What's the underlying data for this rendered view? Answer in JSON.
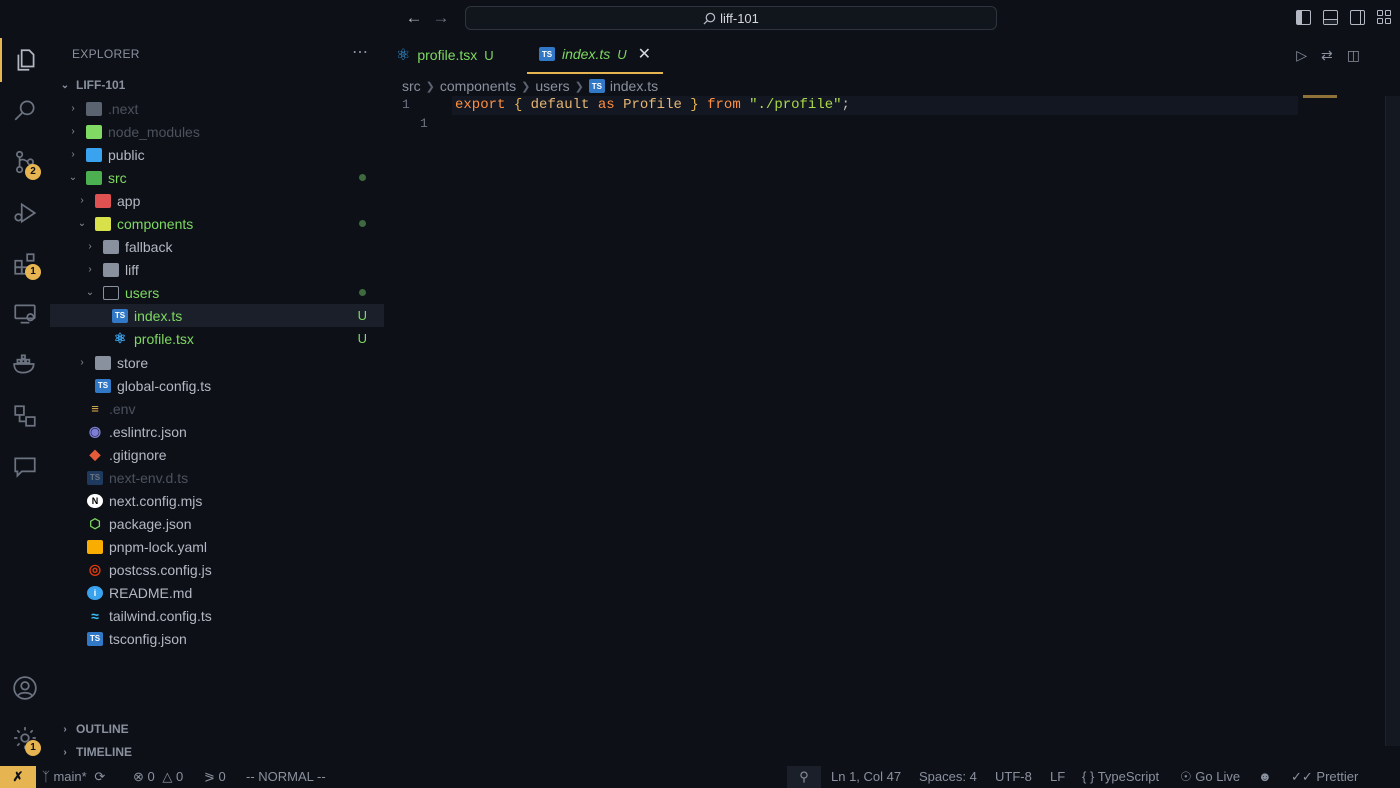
{
  "titlebar": {
    "search_text": "liff-101"
  },
  "activity": {
    "scm_badge": "2",
    "extensions_badge": "1",
    "settings_badge": "1"
  },
  "sidebar": {
    "title": "EXPLORER",
    "root": "LIFF-101",
    "items": [
      {
        "label": ".next"
      },
      {
        "label": "node_modules"
      },
      {
        "label": "public"
      },
      {
        "label": "src"
      },
      {
        "label": "app"
      },
      {
        "label": "components"
      },
      {
        "label": "fallback"
      },
      {
        "label": "liff"
      },
      {
        "label": "users"
      },
      {
        "label": "index.ts",
        "status": "U"
      },
      {
        "label": "profile.tsx",
        "status": "U"
      },
      {
        "label": "store"
      },
      {
        "label": "global-config.ts"
      },
      {
        "label": ".env"
      },
      {
        "label": ".eslintrc.json"
      },
      {
        "label": ".gitignore"
      },
      {
        "label": "next-env.d.ts"
      },
      {
        "label": "next.config.mjs"
      },
      {
        "label": "package.json"
      },
      {
        "label": "pnpm-lock.yaml"
      },
      {
        "label": "postcss.config.js"
      },
      {
        "label": "README.md"
      },
      {
        "label": "tailwind.config.ts"
      },
      {
        "label": "tsconfig.json"
      }
    ],
    "outline": "OUTLINE",
    "timeline": "TIMELINE"
  },
  "tabs": [
    {
      "label": "profile.tsx",
      "status": "U"
    },
    {
      "label": "index.ts",
      "status": "U"
    }
  ],
  "breadcrumb": [
    "src",
    "components",
    "users",
    "index.ts"
  ],
  "editor": {
    "line_numbers": [
      "1",
      "1"
    ],
    "code": {
      "t1": "export",
      "t2": "{",
      "t3": "default",
      "t4": "as",
      "t5": "Profile",
      "t6": "}",
      "t7": "from",
      "t8": "\"./profile\"",
      "t9": ";"
    }
  },
  "statusbar": {
    "branch": "main*",
    "errors": "0",
    "warnings": "0",
    "ports": "0",
    "mode": "-- NORMAL --",
    "position": "Ln 1, Col 47",
    "spaces": "Spaces: 4",
    "encoding": "UTF-8",
    "eol": "LF",
    "language": "TypeScript",
    "golive": "Go Live",
    "prettier": "Prettier"
  },
  "colors": {
    "accent": "#e6b450",
    "untracked": "#7fd962",
    "background": "#0d1017"
  }
}
